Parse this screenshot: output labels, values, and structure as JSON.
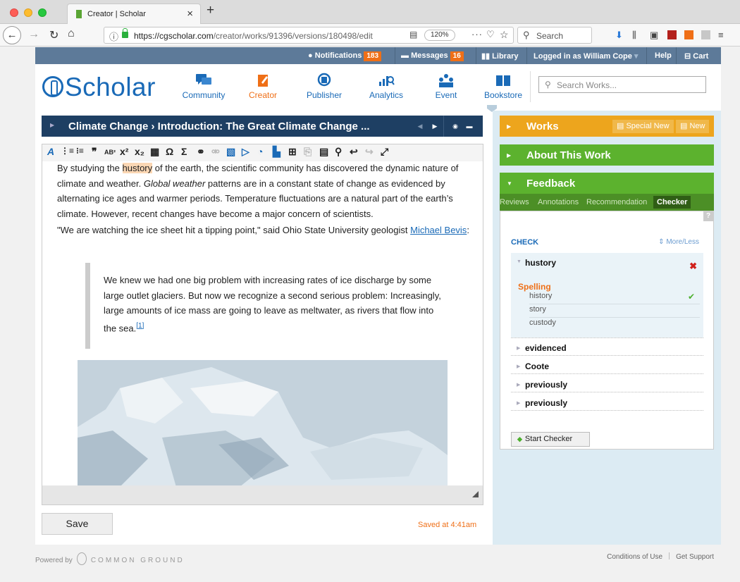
{
  "browser": {
    "tab_title": "Creator | Scholar",
    "url_host": "https://cgscholar.com",
    "url_path": "/creator/works/91396/versions/180498/edit",
    "zoom": "120%",
    "search_placeholder": "Search"
  },
  "topstrip": {
    "notifications_label": "Notifications",
    "notifications_count": "183",
    "messages_label": "Messages",
    "messages_count": "16",
    "library_label": "Library",
    "logged_in": "Logged in as William Cope",
    "help": "Help",
    "cart": "Cart"
  },
  "header": {
    "logo": "Scholar",
    "nav": [
      "Community",
      "Creator",
      "Publisher",
      "Analytics",
      "Event",
      "Bookstore"
    ],
    "search_placeholder": "Search Works..."
  },
  "editor": {
    "title": "Climate Change › Introduction: The Great Climate Change ...",
    "para1_a": "By studying the ",
    "para1_hl": "hustory",
    "para1_b": " of the earth, the scientific community has discovered the dynamic nature of climate and weather. ",
    "para1_it": "Global weather",
    "para1_c": " patterns are in a constant state of change as evidenced by alternating ice ages and warmer periods. Temperature fluctuations are a natural part of the earth’s climate. However, recent changes have become a major concern of scientists.",
    "para2_a": "\"We are watching the ice sheet hit a tipping point,\" said Ohio State University geologist ",
    "para2_link": "Michael Bevis",
    "para2_b": ":",
    "quote": "We knew we had one big problem with increasing rates of ice discharge by some large outlet glaciers. But now we recognize a second serious problem: Increasingly, large amounts of ice mass are going to leave as meltwater, as rivers that flow into the sea.",
    "footnote": "[1]",
    "save_label": "Save",
    "saved_status": "Saved at 4:41am"
  },
  "panel": {
    "works_title": "Works",
    "special_new": "Special New",
    "new": "New",
    "about_title": "About This Work",
    "feedback_title": "Feedback",
    "tabs": [
      "Reviews",
      "Annotations",
      "Recommendation",
      "Checker"
    ],
    "check_title": "CHECK",
    "more_less": "More/Less",
    "current_word": "hustory",
    "error_type": "Spelling",
    "suggestions": [
      "history",
      "story",
      "custody"
    ],
    "other_words": [
      "evidenced",
      "Coote",
      "previously",
      "previously"
    ],
    "start_checker": "Start Checker"
  },
  "footer": {
    "powered_by": "Powered by",
    "brand": "COMMON GROUND",
    "conditions": "Conditions of Use",
    "support": "Get Support"
  },
  "colors": {
    "topstrip": "#5d7a99",
    "brand_blue": "#1a6ab7",
    "accent_orange": "#ef6f17",
    "works_yellow": "#eda51d",
    "panel_green": "#5cb22e",
    "editor_title": "#1e3f63"
  }
}
